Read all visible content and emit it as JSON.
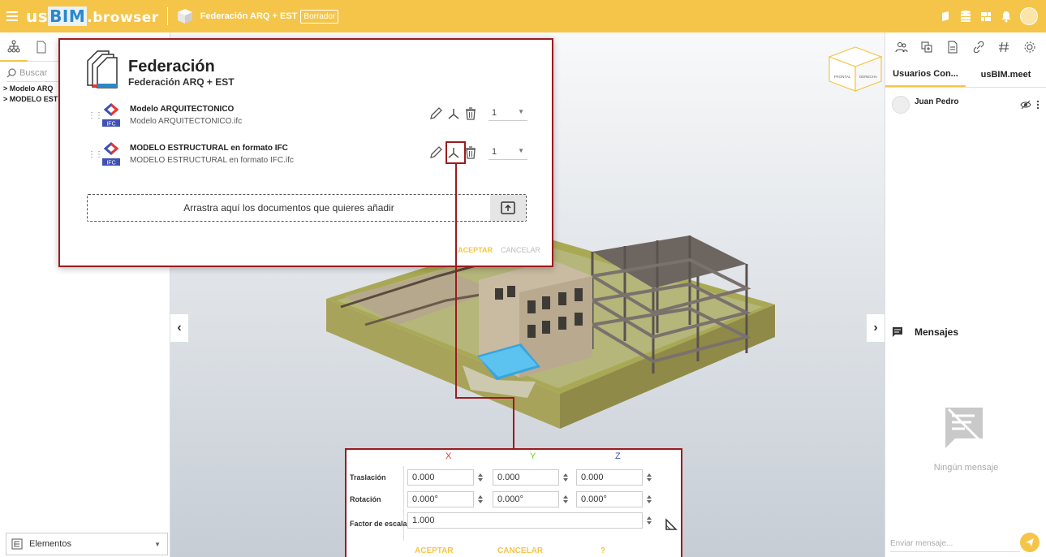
{
  "header": {
    "logo_us": "us",
    "logo_bim": "BIM",
    "logo_browser": ".browser",
    "project_name": "Federación ARQ + EST",
    "draft_badge": "Borrador"
  },
  "left_panel": {
    "search_placeholder": "Buscar",
    "tree_items": [
      "> Modelo ARQ",
      "> MODELO EST"
    ],
    "elementos_label": "Elementos"
  },
  "federation_dialog": {
    "title": "Federación",
    "subtitle": "Federación ARQ + EST",
    "models": [
      {
        "name": "Modelo ARQUITECTONICO",
        "file": "Modelo ARQUITECTONICO.ifc",
        "count": "1",
        "icon_label": "IFC"
      },
      {
        "name": "MODELO ESTRUCTURAL en formato IFC",
        "file": "MODELO ESTRUCTURAL en formato IFC.ifc",
        "count": "1",
        "icon_label": "IFC"
      }
    ],
    "dropzone_text": "Arrastra aquí los documentos que quieres añadir",
    "accept_label": "ACEPTAR",
    "cancel_label": "CANCELAR"
  },
  "navcube": {
    "face_left": "FRONTAL",
    "face_right": "DERECHA"
  },
  "transform_dialog": {
    "axis_x": "X",
    "axis_y": "Y",
    "axis_z": "Z",
    "translation_label": "Traslación",
    "rotation_label": "Rotación",
    "scale_label": "Factor de escala",
    "translation": {
      "x": "0.000",
      "y": "0.000",
      "z": "0.000"
    },
    "rotation": {
      "x": "0.000°",
      "y": "0.000°",
      "z": "0.000°"
    },
    "scale": "1.000",
    "accept_label": "ACEPTAR",
    "cancel_label": "CANCELAR",
    "help_label": "?"
  },
  "right_panel": {
    "tab_users": "Usuarios Con...",
    "tab_meet": "usBIM.meet",
    "user_name": "Juan Pedro",
    "messages_header": "Mensajes",
    "no_messages": "Ningún mensaje",
    "message_placeholder": "Enviar mensaje..."
  },
  "colors": {
    "accent": "#f5c54a",
    "highlight": "#9b1b1e",
    "axis_x": "#e53935",
    "axis_y": "#6fcf2f",
    "axis_z": "#3f51b5"
  }
}
